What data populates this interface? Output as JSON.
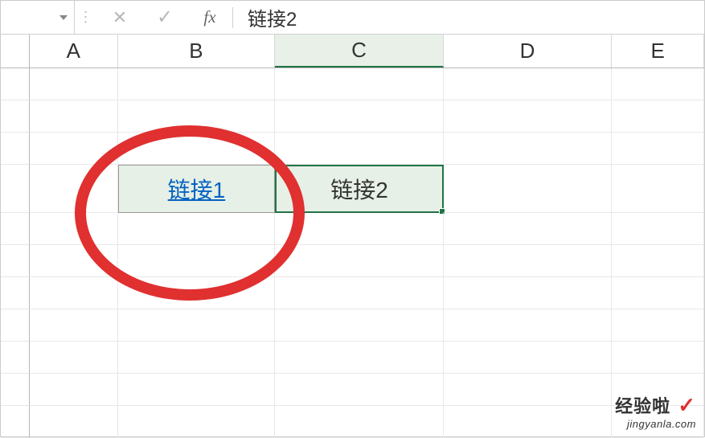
{
  "formula_bar": {
    "name_box_value": "",
    "cancel_icon": "✕",
    "confirm_icon": "✓",
    "fx_label": "fx",
    "content": "链接2"
  },
  "columns": {
    "A": "A",
    "B": "B",
    "C": "C",
    "D": "D",
    "E": "E"
  },
  "cells": {
    "B4": {
      "text": "链接1",
      "is_hyperlink": true
    },
    "C4": {
      "text": "链接2",
      "is_selected": true
    }
  },
  "active_cell": "C4",
  "annotation": {
    "type": "red-circle",
    "target": "B4"
  },
  "watermark": {
    "line1": "经验啦",
    "check": "✓",
    "line2": "jingyanla.com"
  }
}
